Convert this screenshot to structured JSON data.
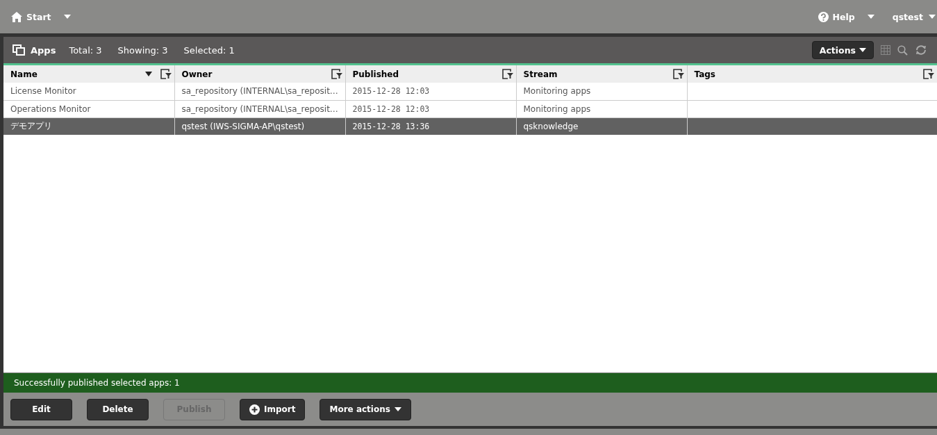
{
  "top_bar": {
    "start": "Start",
    "help": "Help",
    "user": "qstest"
  },
  "apps_header": {
    "title": "Apps",
    "counts": [
      "Total: 3",
      "Showing: 3",
      "Selected: 1"
    ],
    "actions": "Actions"
  },
  "table": {
    "columns": [
      {
        "label": "Name",
        "sorted": true
      },
      {
        "label": "Owner",
        "sorted": false
      },
      {
        "label": "Published",
        "sorted": false
      },
      {
        "label": "Stream",
        "sorted": false
      },
      {
        "label": "Tags",
        "sorted": false
      }
    ],
    "rows": [
      {
        "cells": [
          "License Monitor",
          "sa_repository (INTERNAL\\sa_reposit…",
          "2015-12-28 12:03",
          "Monitoring apps",
          ""
        ],
        "selected": false
      },
      {
        "cells": [
          "Operations Monitor",
          "sa_repository (INTERNAL\\sa_reposit…",
          "2015-12-28 12:03",
          "Monitoring apps",
          ""
        ],
        "selected": false
      },
      {
        "cells": [
          "デモアプリ",
          "qstest (IWS-SIGMA-AP\\qstest)",
          "2015-12-28 13:36",
          "qsknowledge",
          ""
        ],
        "selected": true
      }
    ]
  },
  "message": "Successfully published selected apps: 1",
  "buttons": [
    {
      "label": "Edit",
      "kind": "plain",
      "disabled": false
    },
    {
      "label": "Delete",
      "kind": "plain",
      "disabled": false
    },
    {
      "label": "Publish",
      "kind": "plain",
      "disabled": true
    },
    {
      "label": "Import",
      "kind": "add",
      "disabled": false
    },
    {
      "label": "More actions",
      "kind": "menu",
      "disabled": false
    }
  ]
}
